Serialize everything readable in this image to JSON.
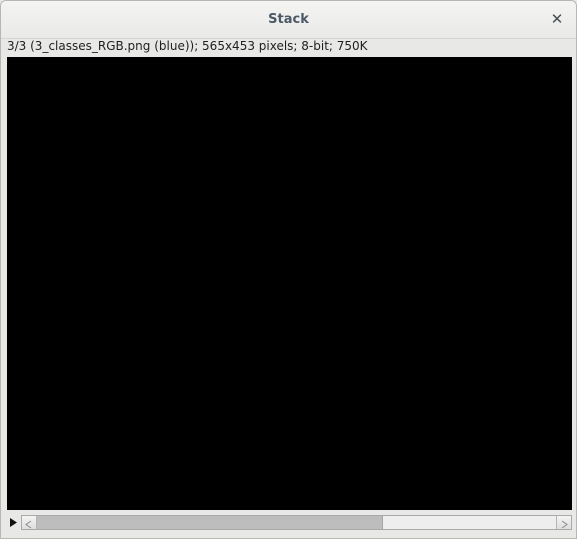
{
  "window": {
    "title": "Stack",
    "close_glyph": "✕"
  },
  "image_info": {
    "text": "3/3 (3_classes_RGB.png (blue)); 565x453 pixels; 8-bit; 750K"
  },
  "canvas": {
    "background": "#000000"
  },
  "slice_slider": {
    "current_slice": 3,
    "total_slices": 3,
    "play_icon": "play-icon"
  },
  "colors": {
    "title_text": "#4b5966",
    "window_bg": "#e8e8e7",
    "scroll_thumb": "#bdbdbd"
  }
}
